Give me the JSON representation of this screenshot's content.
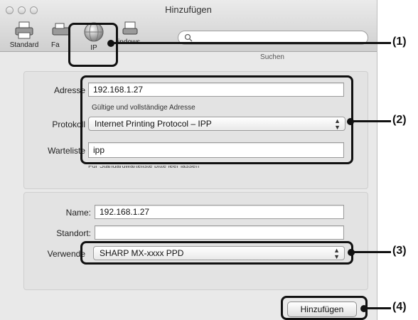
{
  "window": {
    "title": "Hinzufügen"
  },
  "toolbar": {
    "items": [
      {
        "label": "Standard",
        "icon": "printer-icon"
      },
      {
        "label": "Fa",
        "icon": "fax-icon"
      },
      {
        "label": "IP",
        "icon": "globe-icon"
      },
      {
        "label": "indows",
        "icon": "windows-printer-icon"
      }
    ],
    "search_label": "Suchen"
  },
  "protocol_panel": {
    "address_label": "Adresse",
    "address_value": "192.168.1.27",
    "address_hint": "Gültige und vollständige Adresse",
    "protocol_label": "Protokoll",
    "protocol_value": "Internet Printing Protocol – IPP",
    "queue_label": "Warteliste",
    "queue_value": "ipp",
    "queue_hint": "Für Standardwarteliste bitte leer lassen"
  },
  "printer_panel": {
    "name_label": "Name:",
    "name_value": "192.168.1.27",
    "location_label": "Standort:",
    "location_value": "",
    "use_label": "Verwende",
    "use_value": "SHARP MX-xxxx PPD"
  },
  "add_button": "Hinzufügen",
  "callouts": [
    "(1)",
    "(2)",
    "(3)",
    "(4)"
  ]
}
